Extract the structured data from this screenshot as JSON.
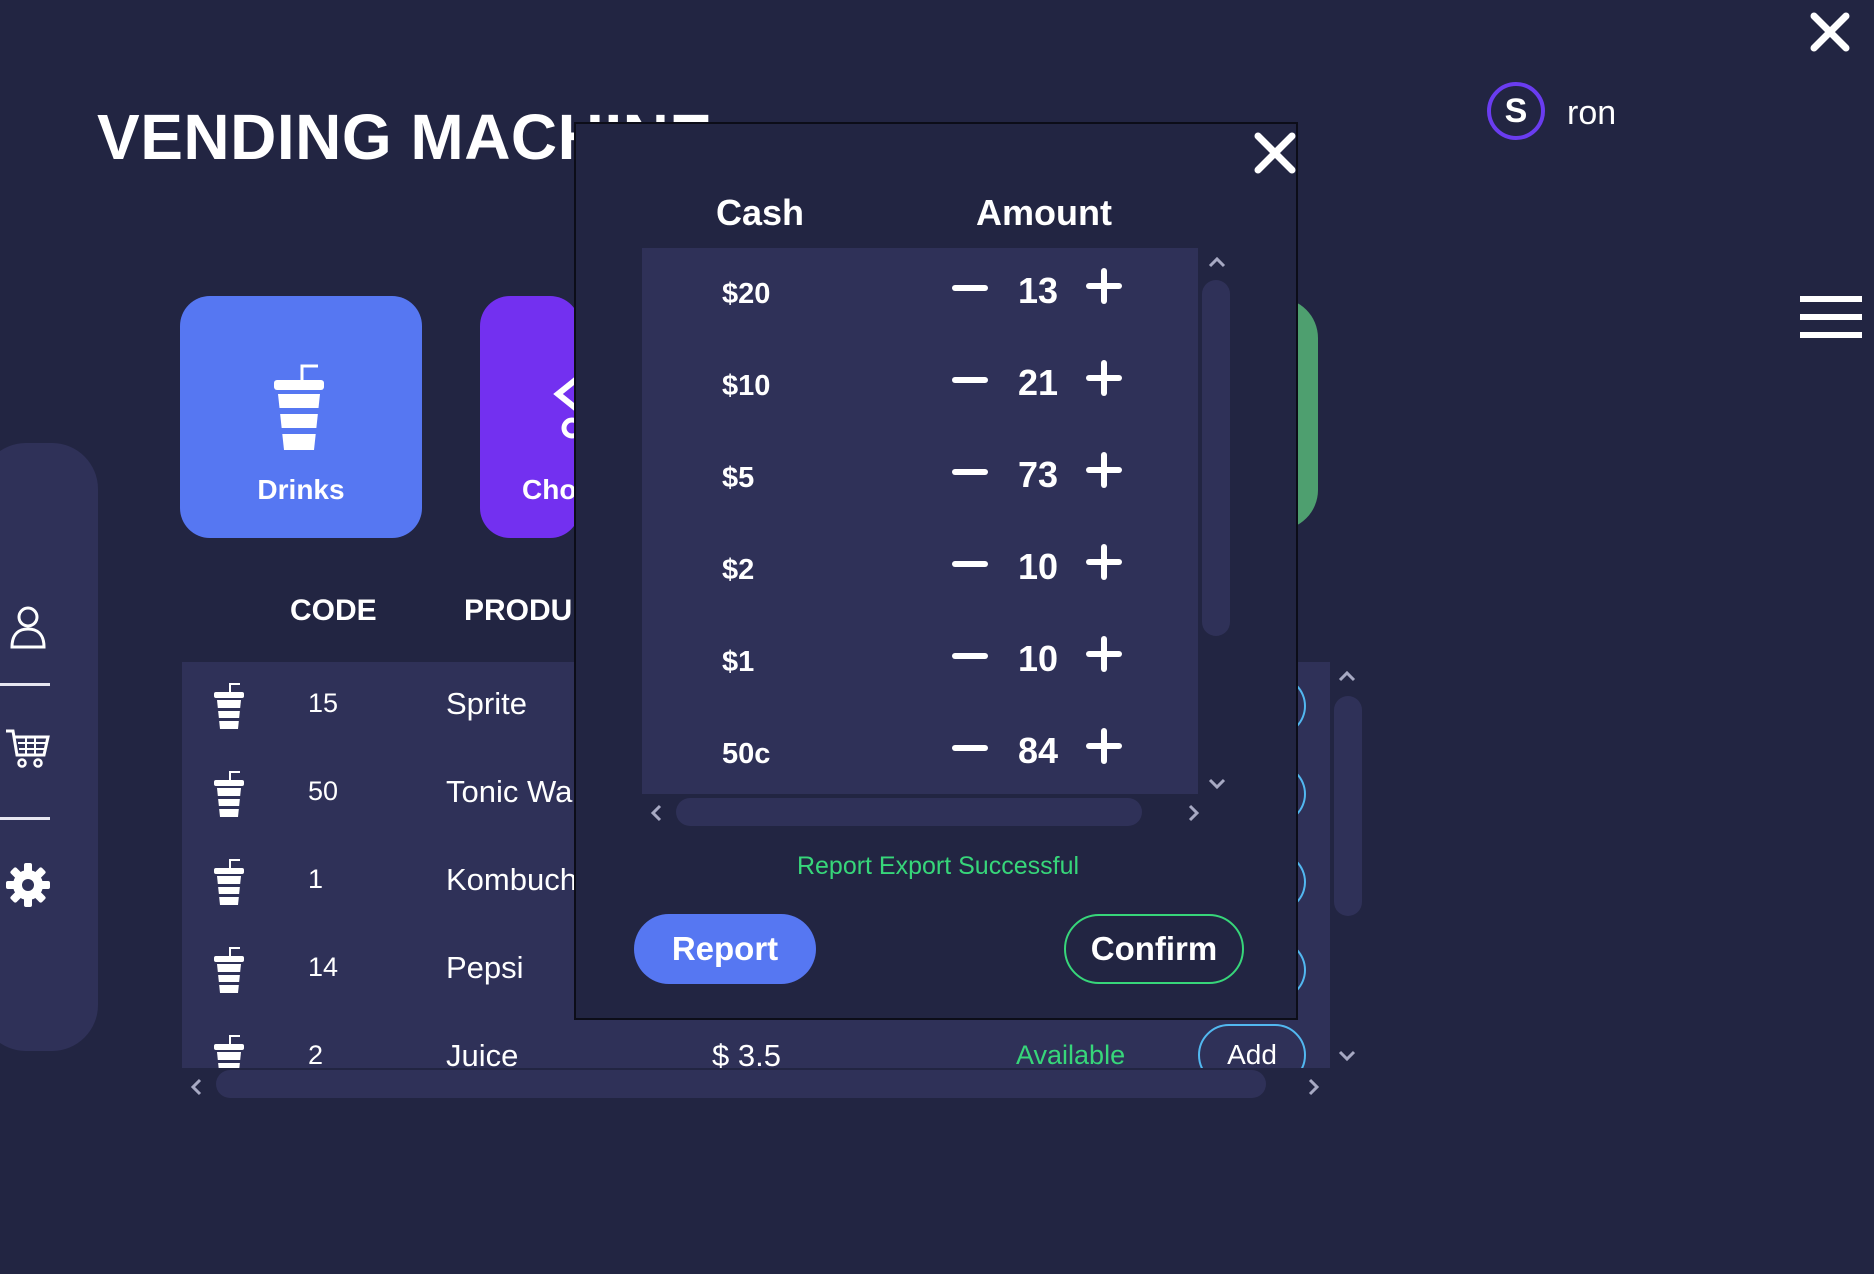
{
  "app": {
    "title": "VENDING MACHINE",
    "user_initial": "S",
    "username": "ron"
  },
  "categories": [
    {
      "label": "Drinks",
      "icon": "cup-icon",
      "color": "#5677f2"
    },
    {
      "label": "Cho",
      "icon": "candy-icon",
      "color": "#7330f0"
    },
    {
      "label": "",
      "icon": "",
      "color": "#4e9f6f"
    }
  ],
  "table": {
    "headers": {
      "code": "CODE",
      "product": "PRODU"
    },
    "rows": [
      {
        "code": "15",
        "name": "Sprite",
        "price": "",
        "status": "",
        "action": ""
      },
      {
        "code": "50",
        "name": "Tonic Wa",
        "price": "",
        "status": "",
        "action": ""
      },
      {
        "code": "1",
        "name": "Kombuch",
        "price": "",
        "status": "",
        "action": ""
      },
      {
        "code": "14",
        "name": "Pepsi",
        "price": "",
        "status": "",
        "action": ""
      },
      {
        "code": "2",
        "name": "Juice",
        "price": "$ 3.5",
        "status": "Available",
        "action": "Add"
      }
    ]
  },
  "cash_modal": {
    "headers": {
      "cash": "Cash",
      "amount": "Amount"
    },
    "rows": [
      {
        "denomination": "$20",
        "quantity": "13"
      },
      {
        "denomination": "$10",
        "quantity": "21"
      },
      {
        "denomination": "$5",
        "quantity": "73"
      },
      {
        "denomination": "$2",
        "quantity": "10"
      },
      {
        "denomination": "$1",
        "quantity": "10"
      },
      {
        "denomination": "50c",
        "quantity": "84"
      }
    ],
    "message": "Report Export Successful",
    "report_label": "Report",
    "confirm_label": "Confirm"
  },
  "colors": {
    "background": "#222542",
    "panel": "#2f3158",
    "accent_blue": "#5677f2",
    "accent_purple": "#7330f0",
    "success_green": "#37d67a"
  }
}
